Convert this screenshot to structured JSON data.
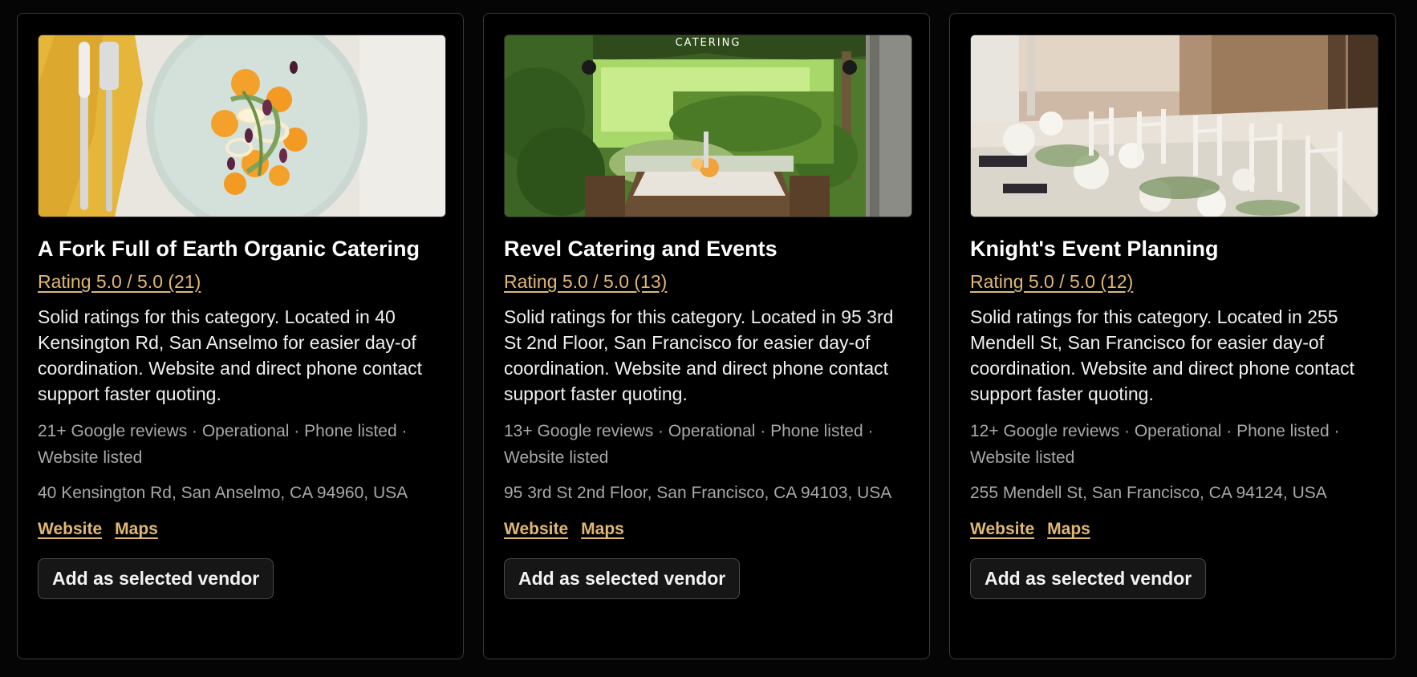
{
  "vendors": [
    {
      "name": "A Fork Full of Earth Organic Catering",
      "rating": "Rating 5.0 / 5.0 (21)",
      "description": "Solid ratings for this category. Located in 40 Kensington Rd, San Anselmo for easier day-of coordination. Website and direct phone contact support faster quoting.",
      "meta": "21+ Google reviews · Operational · Phone listed · Website listed",
      "address": "40 Kensington Rd, San Anselmo, CA 94960, USA",
      "website_label": "Website",
      "maps_label": "Maps",
      "button_label": "Add as selected vendor"
    },
    {
      "name": "Revel Catering and Events",
      "rating": "Rating 5.0 / 5.0 (13)",
      "description": "Solid ratings for this category. Located in 95 3rd St 2nd Floor, San Francisco for easier day-of coordination. Website and direct phone contact support faster quoting.",
      "meta": "13+ Google reviews · Operational · Phone listed · Website listed",
      "address": "95 3rd St 2nd Floor, San Francisco, CA 94103, USA",
      "website_label": "Website",
      "maps_label": "Maps",
      "button_label": "Add as selected vendor",
      "photo_caption": "CATERING"
    },
    {
      "name": "Knight's Event Planning",
      "rating": "Rating 5.0 / 5.0 (12)",
      "description": "Solid ratings for this category. Located in 255 Mendell St, San Francisco for easier day-of coordination. Website and direct phone contact support faster quoting.",
      "meta": "12+ Google reviews · Operational · Phone listed · Website listed",
      "address": "255 Mendell St, San Francisco, CA 94124, USA",
      "website_label": "Website",
      "maps_label": "Maps",
      "button_label": "Add as selected vendor"
    }
  ],
  "colors": {
    "accent": "#e0b873",
    "background": "#000000",
    "card_border": "#3a3a3a",
    "muted_text": "#a8a8a8"
  }
}
